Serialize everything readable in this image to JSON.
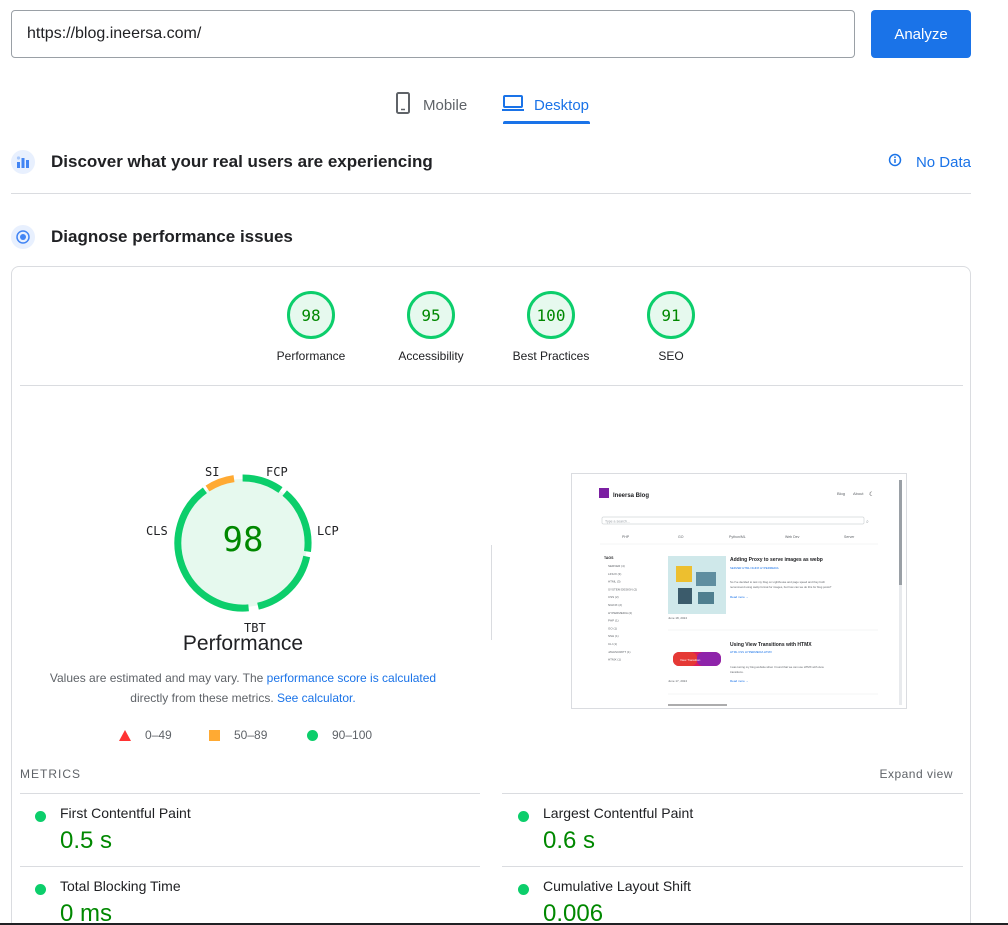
{
  "header": {
    "url_value": "https://blog.ineersa.com/",
    "analyze_label": "Analyze"
  },
  "tabs": [
    {
      "label": "Mobile",
      "icon": "mobile-icon"
    },
    {
      "label": "Desktop",
      "icon": "desktop-icon",
      "selected": true
    }
  ],
  "field_data": {
    "title": "Discover what your real users are experiencing",
    "status": "No Data"
  },
  "diagnose": {
    "title": "Diagnose performance issues"
  },
  "scores": [
    {
      "label": "Performance",
      "value": "98"
    },
    {
      "label": "Accessibility",
      "value": "95"
    },
    {
      "label": "Best Practices",
      "value": "100"
    },
    {
      "label": "SEO",
      "value": "91"
    }
  ],
  "performance": {
    "score": "98",
    "title": "Performance",
    "gauge_labels": {
      "si": "SI",
      "fcp": "FCP",
      "lcp": "LCP",
      "tbt": "TBT",
      "cls": "CLS"
    },
    "estimate_text_1": "Values are estimated and may vary. The ",
    "estimate_link_1": "performance score is calculated",
    "estimate_text_2": " directly from these metrics. ",
    "estimate_link_2": "See calculator."
  },
  "legend": [
    {
      "range": "0–49",
      "color": "#ff3333"
    },
    {
      "range": "50–89",
      "color": "#ffaa33"
    },
    {
      "range": "90–100",
      "color": "#0cce6b"
    }
  ],
  "metrics": {
    "header": "METRICS",
    "expand_label": "Expand view",
    "items": [
      {
        "name": "First Contentful Paint",
        "value": "0.5 s"
      },
      {
        "name": "Largest Contentful Paint",
        "value": "0.6 s"
      },
      {
        "name": "Total Blocking Time",
        "value": "0 ms"
      },
      {
        "name": "Cumulative Layout Shift",
        "value": "0.006"
      }
    ]
  },
  "thumbnail": {
    "site_name": "Ineersa Blog",
    "nav": [
      "Blog",
      "About"
    ],
    "search_placeholder": "Type a search...",
    "categories": [
      "PHP",
      "GO",
      "Python/ML",
      "Web Dev",
      "Server"
    ],
    "tags_header": "TAGS",
    "tags": [
      "SERVER (4)",
      "LINUX (3)",
      "HTML (3)",
      "SYSTEM DESIGN (2)",
      "CSS (2)",
      "NGINX (2)",
      "HYPERMEDIA (2)",
      "PHP (1)",
      "GO (1)",
      "SSH (1)",
      "CLI (1)",
      "JAVASCRIPT (1)",
      "HTMX (1)"
    ],
    "posts": [
      {
        "title": "Adding Proxy to serve images as webp",
        "tags": "SERVER  HTML  NGINX  HYPERMEDIA",
        "excerpt": "So I've decided to test my blog on Lighthouse and page speed and they both recommend using webp format for images, but how can we do this for blog posts?",
        "read_more": "Read more →",
        "date": "June 18, 2024"
      },
      {
        "title": "Using View Transitions with HTMX",
        "tags": "HTML  CSS  HYPERMEDIA  HTMX",
        "excerpt": "I was tuning my blog website when I found that we can use HTMX with view transitions.",
        "read_more": "Read more →",
        "date": "June 17, 2024",
        "banner": "View Transition"
      }
    ]
  },
  "colors": {
    "accent": "#1a73e8",
    "pass": "#0cce6b",
    "pass_text": "#008800",
    "average": "#ffaa33",
    "fail": "#ff3333"
  }
}
